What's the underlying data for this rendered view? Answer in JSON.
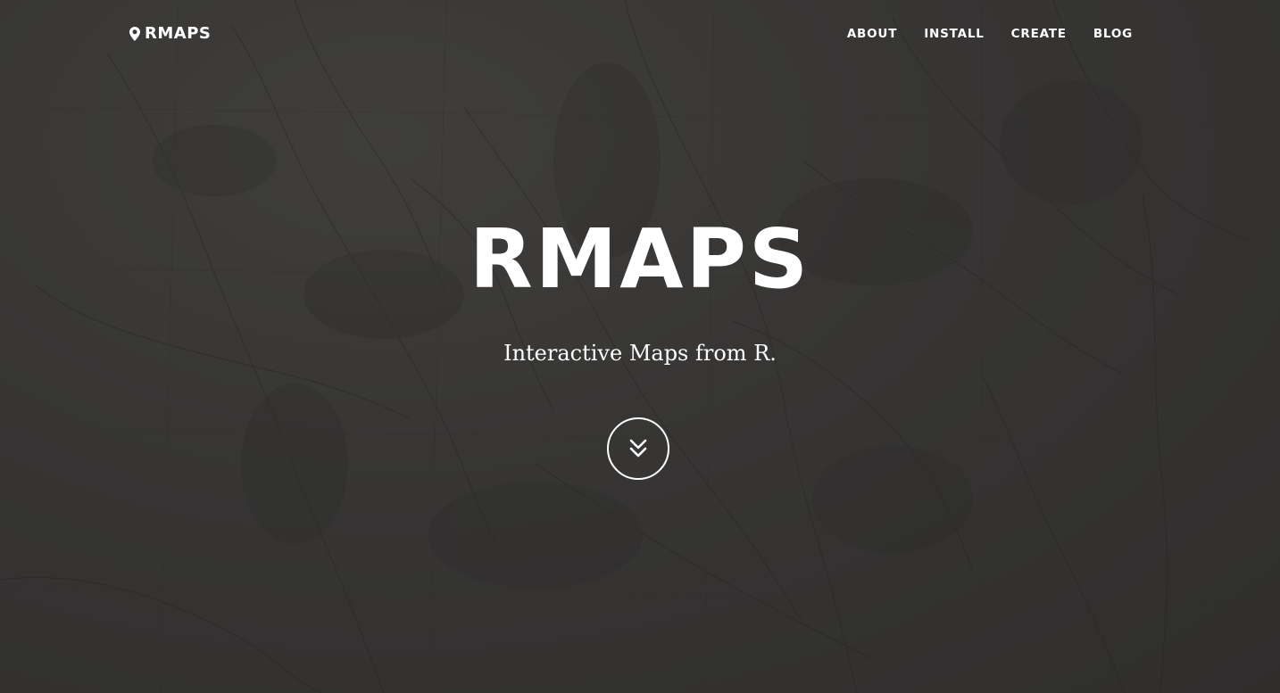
{
  "nav": {
    "brand": "RMAPS",
    "brand_icon": "map-marker-icon",
    "links": [
      "ABOUT",
      "INSTALL",
      "CREATE",
      "BLOG"
    ]
  },
  "hero": {
    "title": "RMAPS",
    "subtitle": "Interactive Maps from R.",
    "scroll_icon": "double-chevron-down-icon"
  },
  "colors": {
    "background": "#3a3938",
    "text": "#ffffff"
  }
}
